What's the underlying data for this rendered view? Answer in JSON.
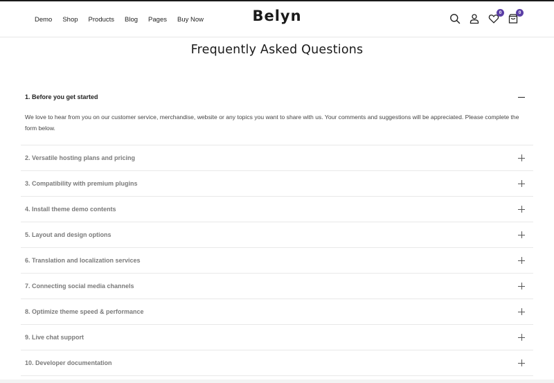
{
  "nav": {
    "items": [
      "Demo",
      "Shop",
      "Products",
      "Blog",
      "Pages",
      "Buy Now"
    ]
  },
  "brand": {
    "logo": "Belyn"
  },
  "header_icons": {
    "wishlist_count": "0",
    "cart_count": "0"
  },
  "page": {
    "title": "Frequently Asked Questions"
  },
  "faq": [
    {
      "question": "1. Before you get started",
      "open": true,
      "answer": "We love to hear from you on our customer service, merchandise, website or any topics you want to share with us. Your comments and suggestions will be appreciated. Please complete the form below."
    },
    {
      "question": "2. Versatile hosting plans and pricing",
      "open": false
    },
    {
      "question": "3. Compatibility with premium plugins",
      "open": false
    },
    {
      "question": "4. Install theme demo contents",
      "open": false
    },
    {
      "question": "5. Layout and design options",
      "open": false
    },
    {
      "question": "6. Translation and localization services",
      "open": false
    },
    {
      "question": "7. Connecting social media channels",
      "open": false
    },
    {
      "question": "8. Optimize theme speed & performance",
      "open": false
    },
    {
      "question": "9. Live chat support",
      "open": false
    },
    {
      "question": "10. Developer documentation",
      "open": false
    }
  ]
}
